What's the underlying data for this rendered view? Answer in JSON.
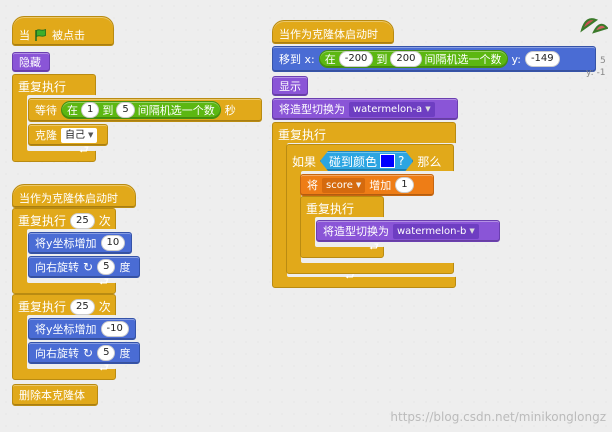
{
  "script1": {
    "hat_prefix": "当",
    "hat_suffix": "被点击",
    "hide": "隐藏",
    "forever": "重复执行",
    "wait_prefix": "等待",
    "wait_in": "在",
    "wait_from": "1",
    "wait_to_word": "到",
    "wait_to": "5",
    "wait_random": "间隔机选一个数",
    "wait_unit": "秒",
    "clone": "克隆",
    "clone_target": "自己",
    "end_arrow": "⮐"
  },
  "script2": {
    "hat": "当作为克隆体启动时",
    "repeat1": "重复执行",
    "repeat1_count": "25",
    "times": "次",
    "change_y_label": "将y坐标增加",
    "change_y_1": "10",
    "turn_right": "向右旋转",
    "turn_deg_1": "5",
    "deg": "度",
    "repeat2": "重复执行",
    "repeat2_count": "25",
    "change_y_2": "-10",
    "turn_deg_2": "5",
    "delete_clone": "删除本克隆体"
  },
  "script3": {
    "hat": "当作为克隆体启动时",
    "goto_prefix": "移到 x:",
    "goto_in": "在",
    "goto_from": "-200",
    "goto_to_word": "到",
    "goto_to": "200",
    "goto_random": "间隔机选一个数",
    "goto_y": "y:",
    "goto_y_value": "-149",
    "show": "显示",
    "switch_costume": "将造型切换为",
    "costume_a": "watermelon-a",
    "forever": "重复执行",
    "if": "如果",
    "touching_color": "碰到颜色",
    "question": "?",
    "then": "那么",
    "change_var_prefix": "将",
    "var_name": "score",
    "change_var_suffix": "增加",
    "change_amount": "1",
    "inner_forever": "重复执行",
    "costume_b": "watermelon-b"
  },
  "sprite_info": {
    "x_label": "5",
    "y_label": "y: -1"
  },
  "watermark": "https://blog.csdn.net/minikonglongz",
  "colors": {
    "control": "#e1a91a",
    "looks": "#8a55d7",
    "motion": "#4a6cd4",
    "operators": "#5cb712",
    "data": "#ee7d16",
    "sensing": "#2ca5e2",
    "touch_swatch": "#0000ff"
  }
}
